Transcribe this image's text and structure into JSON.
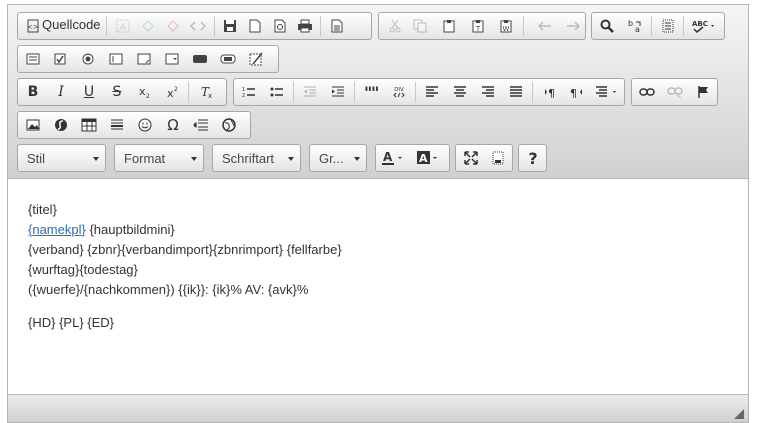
{
  "toolbar": {
    "source_label": "Quellcode",
    "style_combo": "Stil",
    "format_combo": "Format",
    "font_combo": "Schriftart",
    "size_combo": "Gr...",
    "bold_label": "B",
    "italic_label": "I",
    "underline_label": "U",
    "strike_label": "S",
    "help_label": "?"
  },
  "content": {
    "line1": "{titel}",
    "line2_link": "{namekpl}",
    "line2_rest": " {hauptbildmini}",
    "line3": "{verband} {zbnr}{verbandimport}{zbnrimport} {fellfarbe}",
    "line4": "{wurftag}{todestag}",
    "line5": "({wuerfe}/{nachkommen}) {{ik}}: {ik}% AV: {avk}%",
    "line6": "{HD} {PL} {ED}"
  },
  "colors": {
    "link": "#2b6eb7",
    "toolbar_bg": "#e4e4e4",
    "text": "#333333"
  }
}
